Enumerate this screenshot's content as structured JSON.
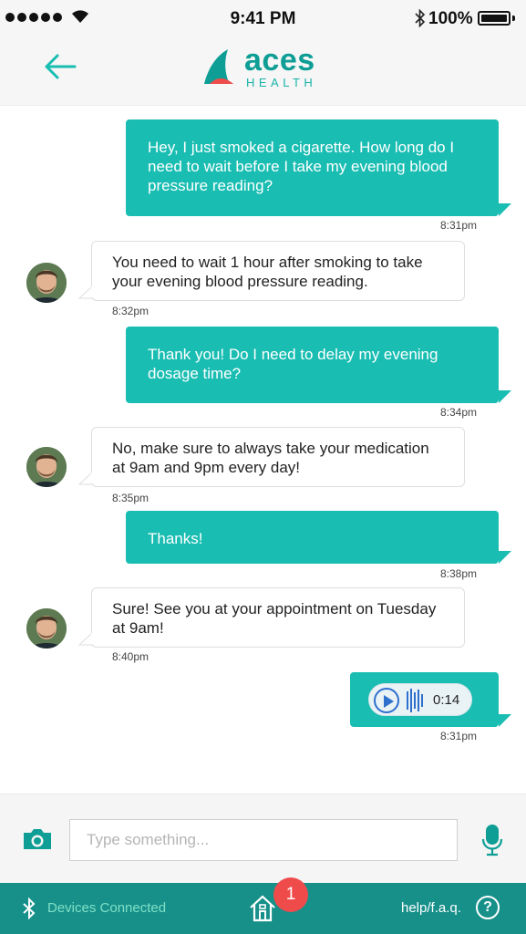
{
  "status_bar": {
    "time": "9:41 PM",
    "battery": "100%",
    "icons": [
      "signal-dots-icon",
      "wifi-icon",
      "bluetooth-icon",
      "battery-icon"
    ]
  },
  "header": {
    "back_icon": "arrow-left-icon",
    "logo_name": "aces",
    "logo_sub": "HEALTH"
  },
  "messages": [
    {
      "direction": "out",
      "text": "Hey, I just smoked a cigarette. How long do I need to wait before I take my evening blood pressure reading?",
      "time": "8:31pm"
    },
    {
      "direction": "in",
      "text": "You need to wait 1 hour after smoking to take your evening blood pressure reading.",
      "time": "8:32pm"
    },
    {
      "direction": "out",
      "text": "Thank you! Do I need to delay my evening dosage time?",
      "time": "8:34pm"
    },
    {
      "direction": "in",
      "text": "No, make sure to always take your medication at 9am and 9pm every day!",
      "time": "8:35pm"
    },
    {
      "direction": "out",
      "text": "Thanks!",
      "time": "8:38pm"
    },
    {
      "direction": "in",
      "text": "Sure! See you at your appointment on Tuesday at 9am!",
      "time": "8:40pm"
    },
    {
      "direction": "out",
      "type": "voice",
      "duration": "0:14",
      "time": "8:31pm"
    }
  ],
  "composer": {
    "placeholder": "Type something...",
    "camera_icon": "camera-icon",
    "mic_icon": "microphone-icon"
  },
  "bottom_bar": {
    "devices_label": "Devices Connected",
    "home_badge": "1",
    "help_label": "help/f.a.q.",
    "help_icon_text": "?"
  },
  "colors": {
    "accent": "#19bdb2",
    "bottom_bar": "#17908a",
    "badge": "#f04b4b",
    "devices_text": "#7fe0c6"
  }
}
